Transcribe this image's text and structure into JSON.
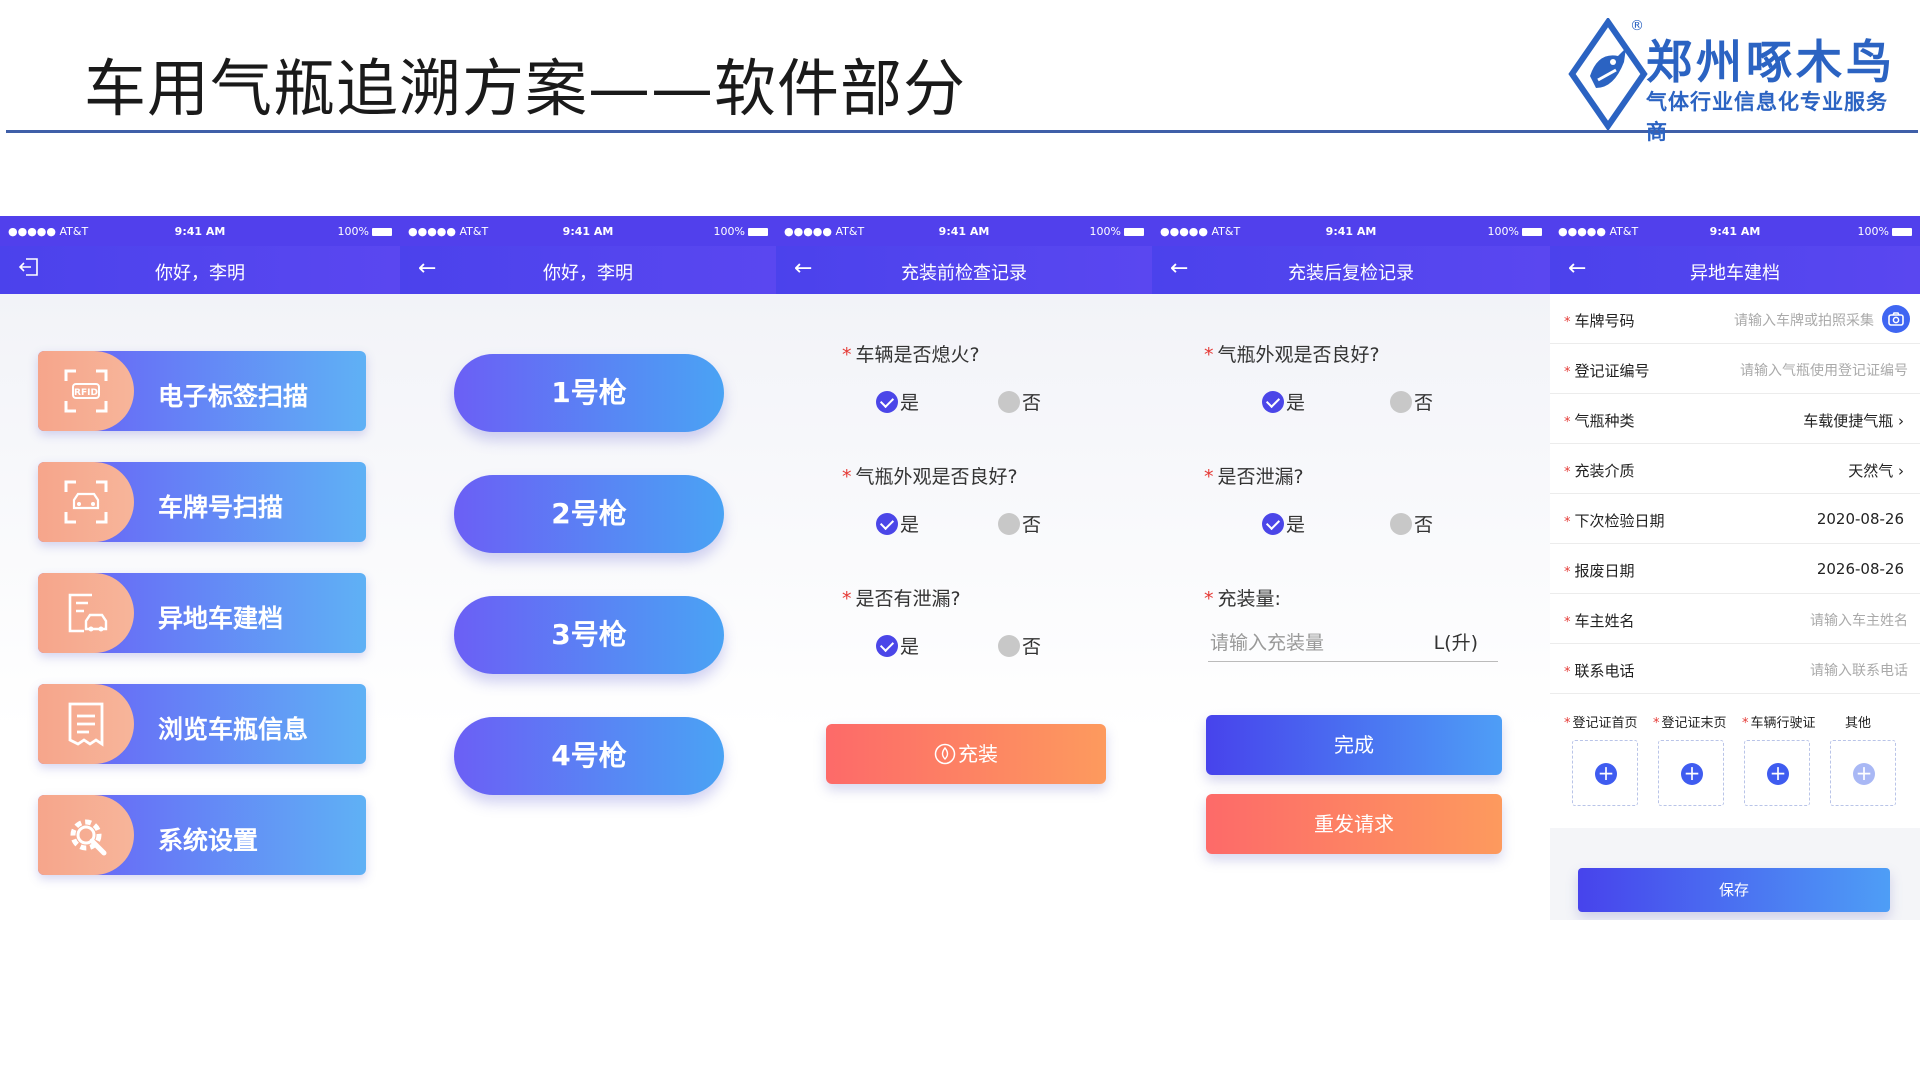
{
  "slide": {
    "title": "车用气瓶追溯方案——软件部分",
    "brand_name": "郑州啄木鸟",
    "brand_reg": "®",
    "brand_tagline": "气体行业信息化专业服务商"
  },
  "colors": {
    "primary": "#5140ec",
    "accent_orange": "#fd6a69",
    "accent_blue": "#4e9ef6",
    "rule": "#3f5fa8",
    "brand": "#2b63c2"
  },
  "status": {
    "carrier": "●●●●● AT&T",
    "time": "9:41 AM",
    "battery": "100%"
  },
  "phone1": {
    "title": "你好，李明",
    "back_icon": "logout-icon",
    "menu": [
      {
        "label": "电子标签扫描",
        "icon": "rfid-scan-icon"
      },
      {
        "label": "车牌号扫描",
        "icon": "plate-scan-icon"
      },
      {
        "label": "异地车建档",
        "icon": "car-file-icon"
      },
      {
        "label": "浏览车瓶信息",
        "icon": "list-doc-icon"
      },
      {
        "label": "系统设置",
        "icon": "gear-icon"
      }
    ]
  },
  "phone2": {
    "title": "你好，李明",
    "guns": [
      "1号枪",
      "2号枪",
      "3号枪",
      "4号枪"
    ]
  },
  "phone3": {
    "title": "充装前检查记录",
    "questions": [
      {
        "label": "车辆是否熄火?",
        "star": "*"
      },
      {
        "label": "气瓶外观是否良好?",
        "star": "*"
      },
      {
        "label": "是否有泄漏?",
        "star": "*"
      }
    ],
    "yes": "是",
    "no": "否",
    "button": "充装"
  },
  "phone4": {
    "title": "充装后复检记录",
    "questions": [
      {
        "label": "气瓶外观是否良好?",
        "star": "*"
      },
      {
        "label": "是否泄漏?",
        "star": "*"
      }
    ],
    "yes": "是",
    "no": "否",
    "fill_label": "充装量:",
    "fill_star": "*",
    "fill_placeholder": "请输入充装量",
    "fill_unit": "L(升)",
    "done_button": "完成",
    "resend_button": "重发请求"
  },
  "phone5": {
    "title": "异地车建档",
    "rows": [
      {
        "label": "车牌号码",
        "value": "请输入车牌或拍照采集",
        "placeholder": true
      },
      {
        "label": "登记证编号",
        "value": "请输入气瓶使用登记证编号",
        "placeholder": true
      },
      {
        "label": "气瓶种类",
        "value": "车载便捷气瓶 ›",
        "placeholder": false
      },
      {
        "label": "充装介质",
        "value": "天然气 ›",
        "placeholder": false
      },
      {
        "label": "下次检验日期",
        "value": "2020-08-26",
        "placeholder": false
      },
      {
        "label": "报废日期",
        "value": "2026-08-26",
        "placeholder": false
      },
      {
        "label": "车主姓名",
        "value": "请输入车主姓名",
        "placeholder": true
      },
      {
        "label": "联系电话",
        "value": "请输入联系电话",
        "placeholder": true
      }
    ],
    "uploads": [
      {
        "label": "登记证首页",
        "star": "*"
      },
      {
        "label": "登记证末页",
        "star": "*"
      },
      {
        "label": "车辆行驶证",
        "star": "*"
      },
      {
        "label": "其他",
        "star": ""
      }
    ],
    "save_button": "保存"
  }
}
